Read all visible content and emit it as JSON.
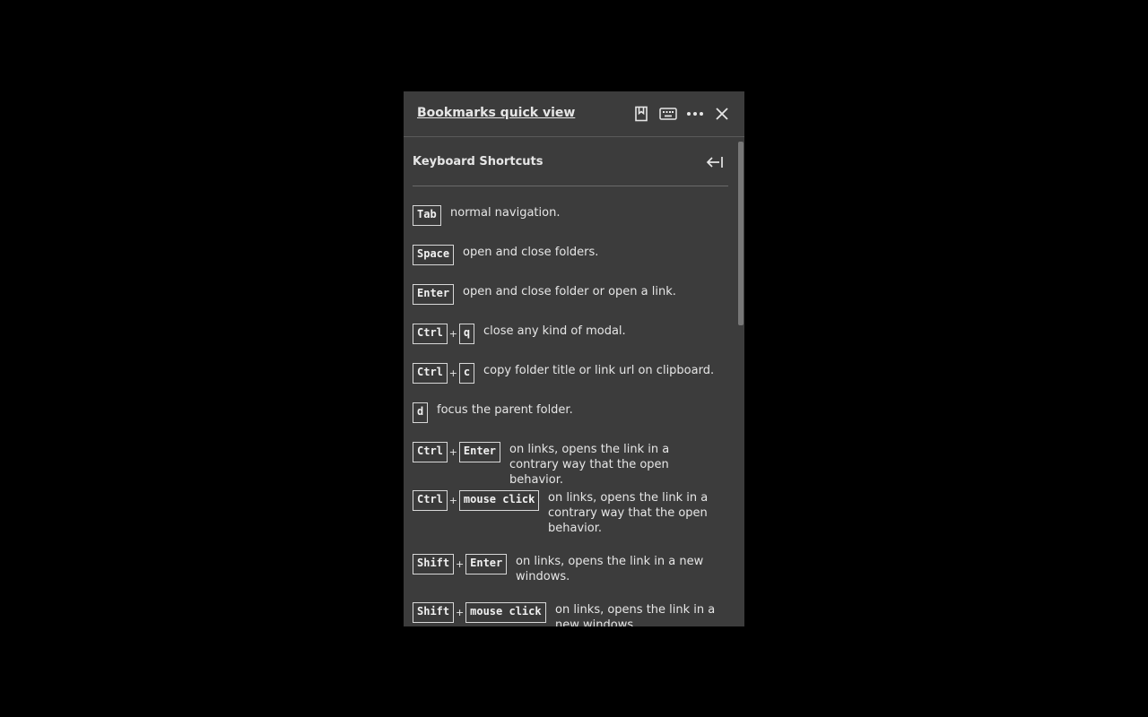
{
  "header": {
    "title": "Bookmarks quick view",
    "icons": [
      "bookmark-icon",
      "keyboard-icon",
      "more-icon",
      "close-icon"
    ]
  },
  "section": {
    "title": "Keyboard Shortcuts",
    "back_icon": "collapse-left-icon"
  },
  "shortcuts": [
    {
      "keys": [
        "Tab"
      ],
      "desc": "normal navigation."
    },
    {
      "keys": [
        "Space"
      ],
      "desc": "open and close folders."
    },
    {
      "keys": [
        "Enter"
      ],
      "desc": "open and close folder or open a link."
    },
    {
      "keys": [
        "Ctrl",
        "q"
      ],
      "desc": "close any kind of modal."
    },
    {
      "keys": [
        "Ctrl",
        "c"
      ],
      "desc": "copy folder title or link url on clipboard."
    },
    {
      "keys": [
        "d"
      ],
      "desc": "focus the parent folder."
    },
    {
      "keys": [
        "Ctrl",
        "Enter"
      ],
      "desc": "on links, opens the link in a contrary way that the open behavior."
    },
    {
      "keys": [
        "Ctrl",
        "mouse click"
      ],
      "desc": "on links, opens the link in a contrary way that the open behavior."
    },
    {
      "keys": [
        "Shift",
        "Enter"
      ],
      "desc": "on links, opens the link in a new windows."
    },
    {
      "keys": [
        "Shift",
        "mouse click"
      ],
      "desc": "on links, opens the link in a new windows."
    }
  ],
  "key_separator": "+",
  "colors": {
    "page_background": "#000000",
    "panel_background": "#3c3c3c",
    "text": "#e6e6e6",
    "divider": "#5a5a5a",
    "scrollbar_thumb": "#777777"
  }
}
